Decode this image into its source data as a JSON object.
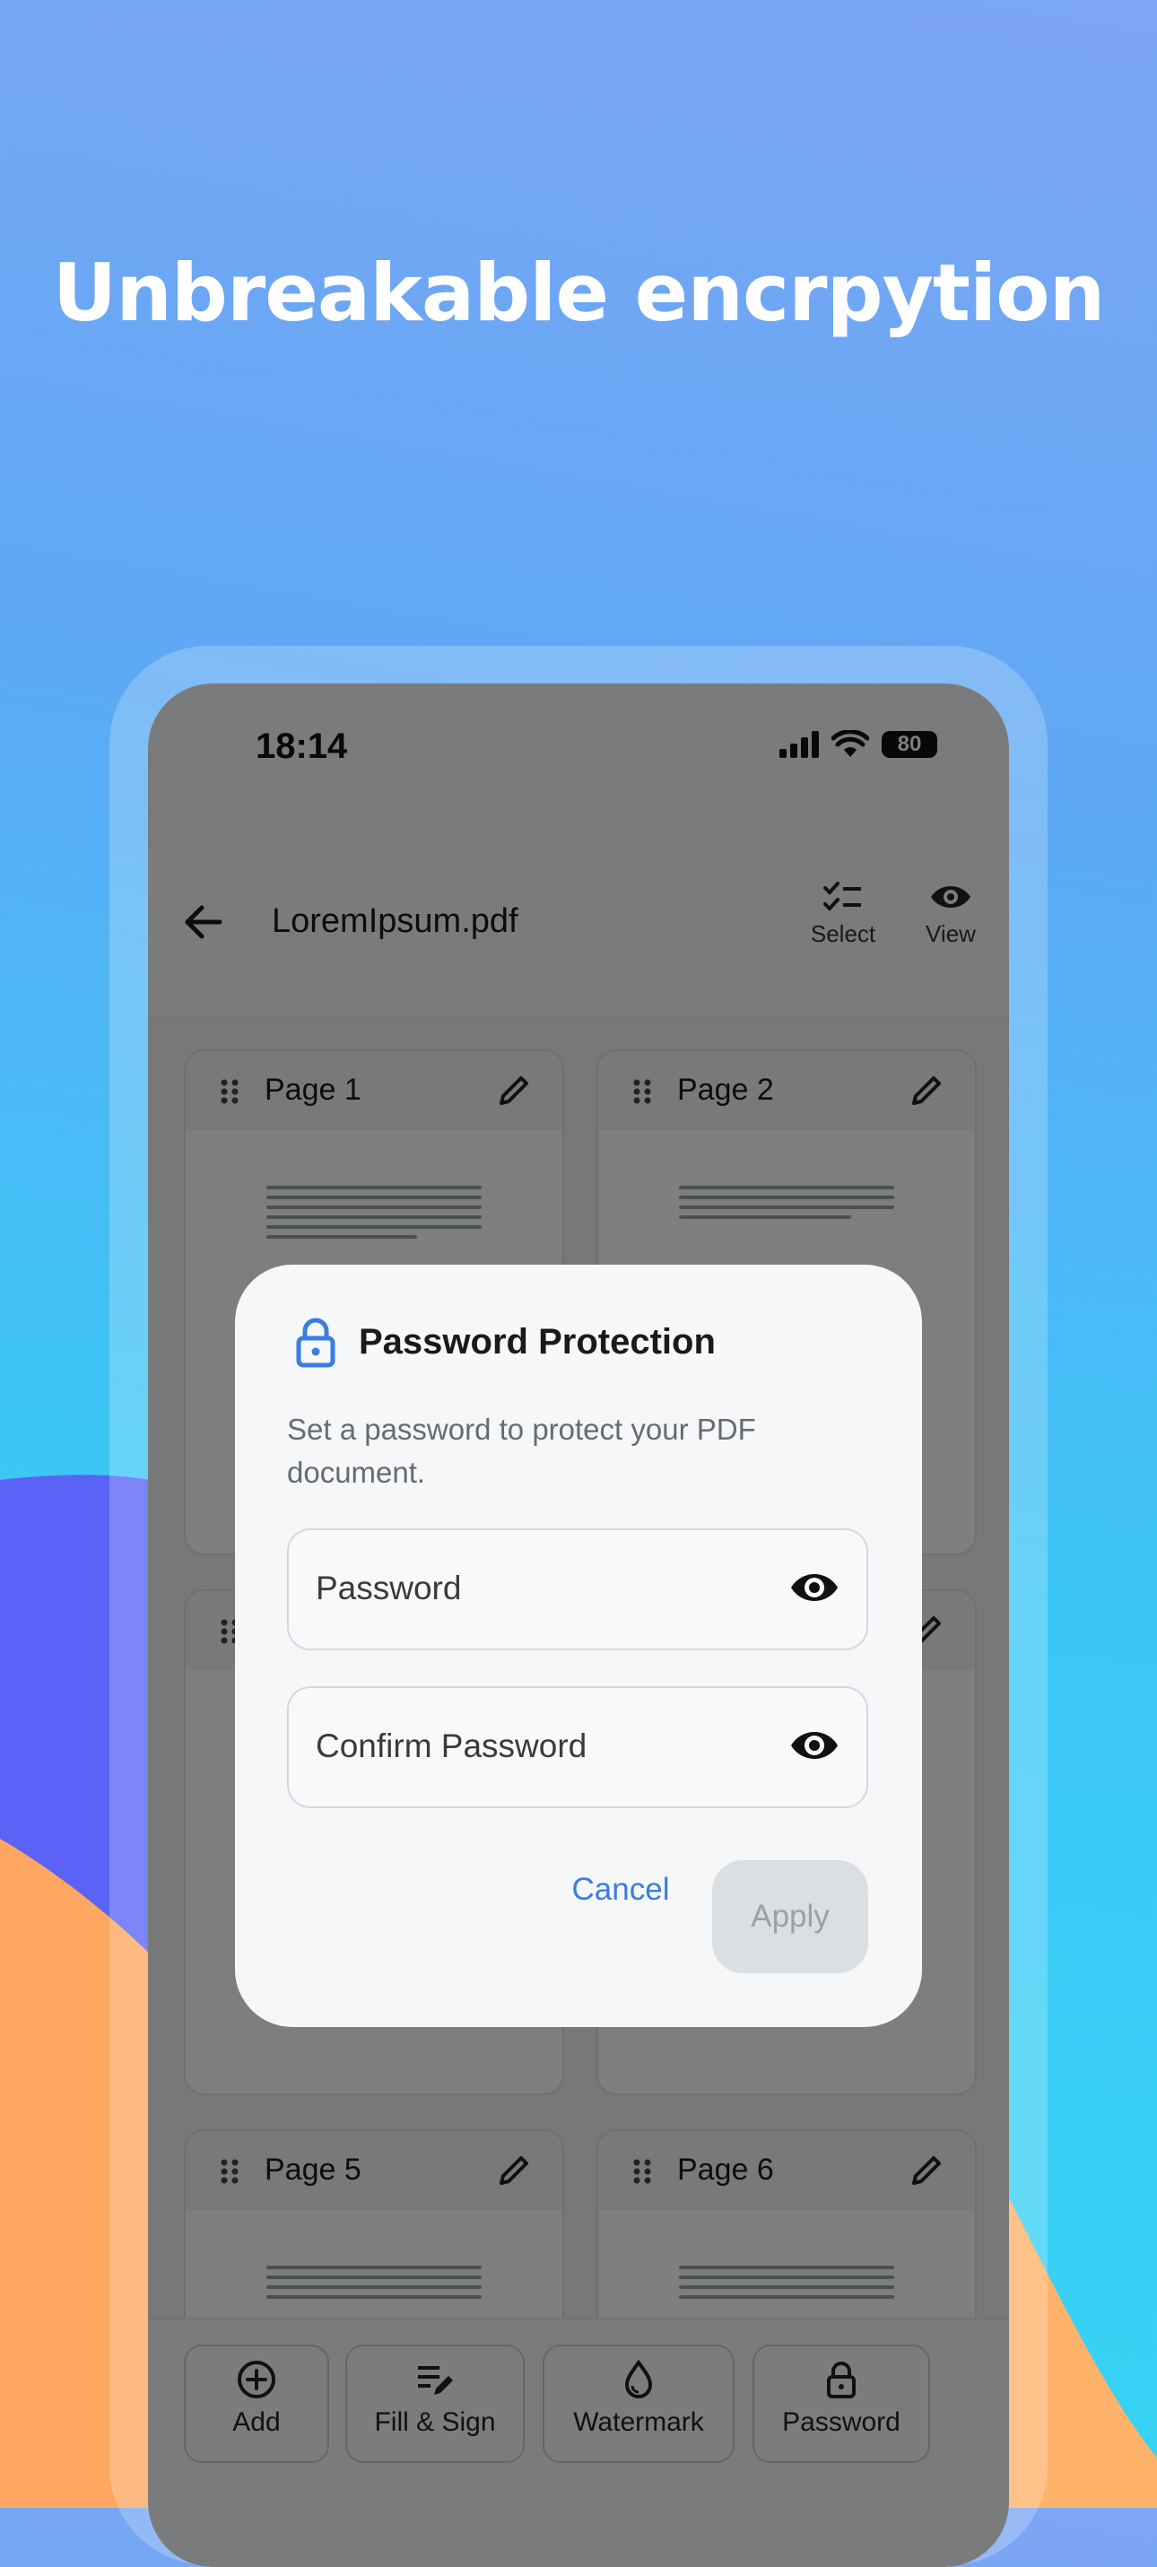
{
  "headline": "Unbreakable encrpytion",
  "colors": {
    "bg_top": "#7ea6f4",
    "bg_bottom": "#35d7f4",
    "blob_purple": "#5a63f5",
    "blob_orange": "#ffb36a",
    "accent_blue": "#3a7de0",
    "lock_blue": "#3a7de0"
  },
  "status_bar": {
    "time": "18:14",
    "battery": "80",
    "icons": [
      "cellular-signal-icon",
      "wifi-icon",
      "battery-icon"
    ]
  },
  "app_bar": {
    "back_icon": "arrow-left-icon",
    "title": "LoremIpsum.pdf",
    "actions": [
      {
        "label": "Select",
        "icon": "checklist-icon"
      },
      {
        "label": "View",
        "icon": "eye-icon"
      }
    ]
  },
  "pages": [
    {
      "label": "Page 1"
    },
    {
      "label": "Page 2"
    },
    {
      "label": "Page 5"
    },
    {
      "label": "Page 6"
    }
  ],
  "toolbar": [
    {
      "label": "Add",
      "icon": "plus-circle-icon"
    },
    {
      "label": "Fill & Sign",
      "icon": "fill-sign-icon"
    },
    {
      "label": "Watermark",
      "icon": "droplet-icon"
    },
    {
      "label": "Password",
      "icon": "lock-icon"
    }
  ],
  "dialog": {
    "icon": "lock-icon",
    "title": "Password Protection",
    "description": "Set a password to protect your PDF document.",
    "password_placeholder": "Password",
    "confirm_placeholder": "Confirm Password",
    "cancel_label": "Cancel",
    "apply_label": "Apply",
    "apply_disabled": true
  }
}
